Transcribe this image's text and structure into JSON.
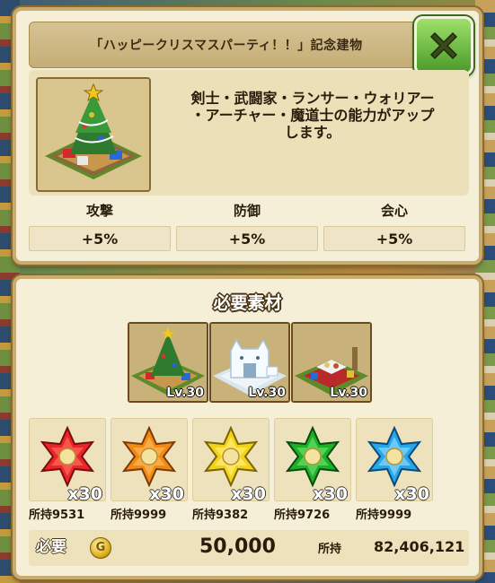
{
  "window": {
    "title": "「ハッピークリスマスパーティ！！」記念建物"
  },
  "building": {
    "description_lines": [
      "剣士・武闘家・ランサー・ウォリアー",
      "・アーチャー・魔道士の能力がアップ",
      "します。"
    ],
    "stats": [
      {
        "label": "攻撃",
        "value": "+5%"
      },
      {
        "label": "防御",
        "value": "+5%"
      },
      {
        "label": "会心",
        "value": "+5%"
      }
    ]
  },
  "materials": {
    "title": "必要素材",
    "buildings": [
      {
        "icon": "christmas-tree-building-icon",
        "level": "Lv.30"
      },
      {
        "icon": "snow-cat-building-icon",
        "level": "Lv.30"
      },
      {
        "icon": "christmas-party-table-building-icon",
        "level": "Lv.30"
      }
    ],
    "gems": [
      {
        "icon": "red-star-gem-icon",
        "color": "#e8262a",
        "qty": "x30",
        "owned": "所持9531"
      },
      {
        "icon": "orange-star-gem-icon",
        "color": "#f08a14",
        "qty": "x30",
        "owned": "所持9999"
      },
      {
        "icon": "yellow-star-gem-icon",
        "color": "#f2d21a",
        "qty": "x30",
        "owned": "所持9382"
      },
      {
        "icon": "green-star-gem-icon",
        "color": "#1fb02a",
        "qty": "x30",
        "owned": "所持9726"
      },
      {
        "icon": "blue-star-gem-icon",
        "color": "#27a6e8",
        "qty": "x30",
        "owned": "所持9999"
      }
    ]
  },
  "cost": {
    "label": "必要",
    "coin_symbol": "G",
    "value": "50,000",
    "owned_label": "所持",
    "owned_value": "82,406,121"
  }
}
